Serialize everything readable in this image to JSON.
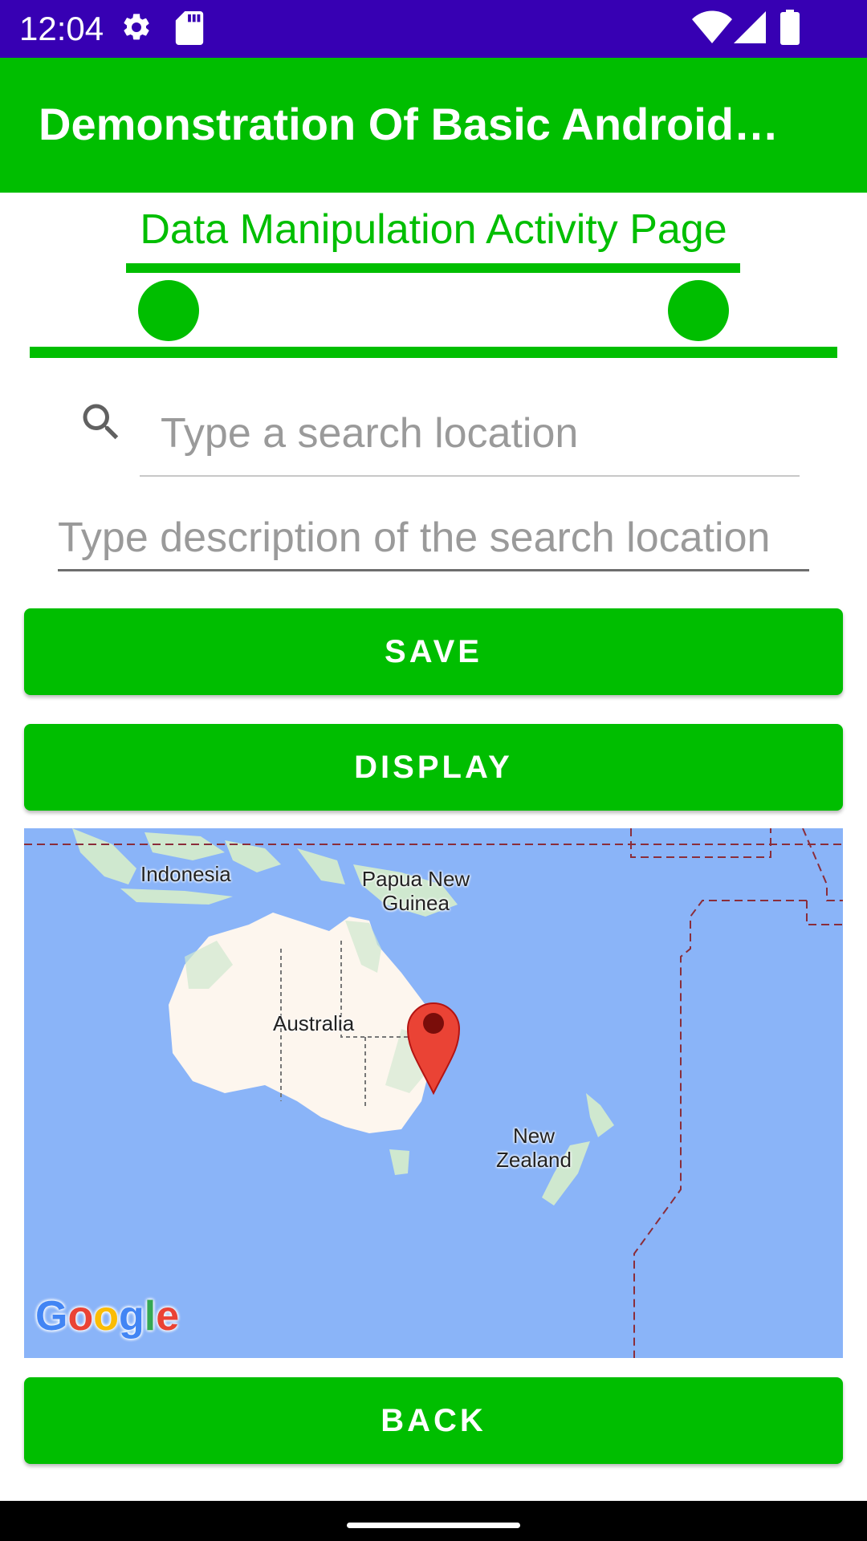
{
  "status_bar": {
    "time": "12:04",
    "icons": [
      "settings-icon",
      "sd-card-icon",
      "wifi-icon",
      "cell-signal-icon",
      "battery-icon"
    ]
  },
  "app_bar": {
    "title": "Demonstration Of Basic Android Features"
  },
  "header": {
    "heading": "Data Manipulation Activity Page"
  },
  "search": {
    "placeholder": "Type a search location",
    "value": ""
  },
  "description": {
    "placeholder": "Type description of the search location",
    "value": ""
  },
  "buttons": {
    "save": "SAVE",
    "display": "DISPLAY",
    "back": "BACK"
  },
  "map": {
    "labels": {
      "indonesia": "Indonesia",
      "papua_new_guinea": "Papua New Guinea",
      "australia": "Australia",
      "new_zealand": "New Zealand"
    },
    "marker": "map-pin-icon",
    "attribution": "Google"
  },
  "colors": {
    "status_bar": "#3700b3",
    "accent": "#00be00",
    "ocean": "#8ab4f8",
    "land": "#fdf6ee",
    "pin": "#ea4335"
  }
}
